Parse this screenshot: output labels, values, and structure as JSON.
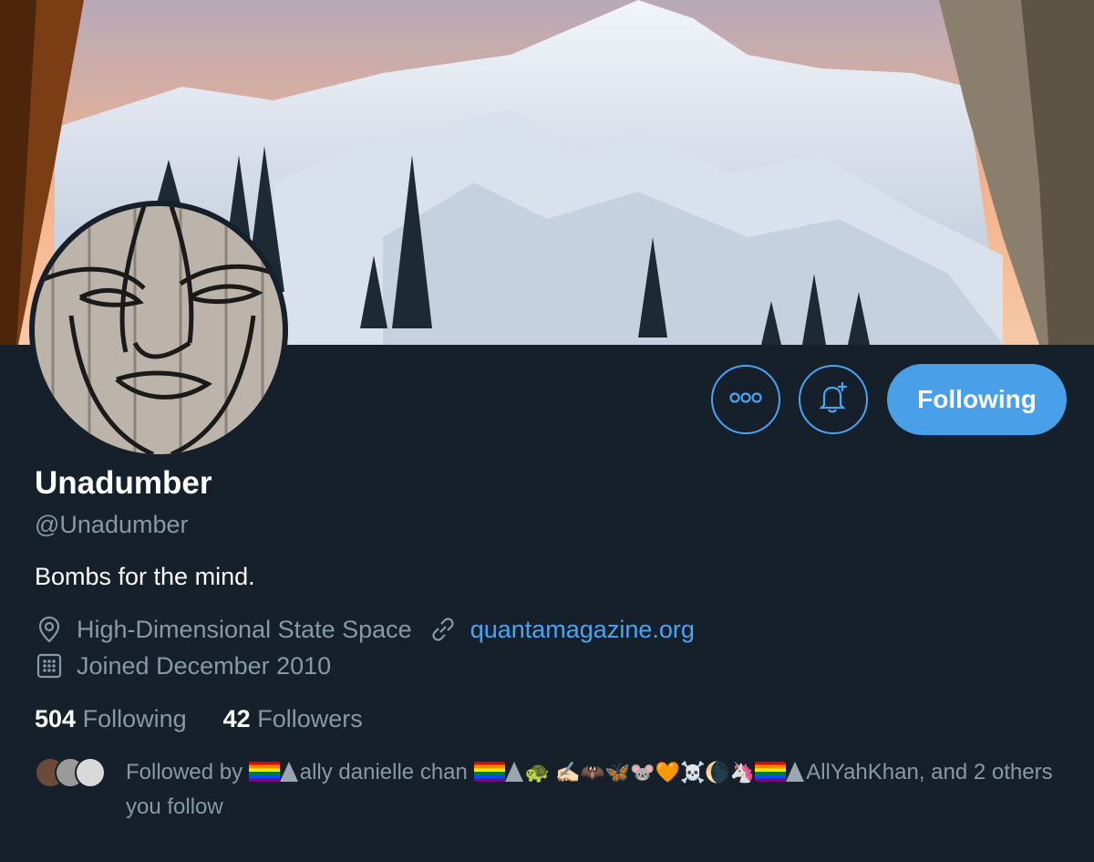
{
  "profile": {
    "display_name": "Unadumber",
    "handle": "@Unadumber",
    "bio": "Bombs for the mind.",
    "location": "High-Dimensional State Space",
    "website": "quantamagazine.org",
    "joined": "Joined December 2010"
  },
  "stats": {
    "following_count": "504",
    "following_label": "Following",
    "followers_count": "42",
    "followers_label": "Followers"
  },
  "actions": {
    "following_button": "Following"
  },
  "followed_by": {
    "prefix": "Followed by",
    "name_1": "ally danielle chan",
    "emoji_run": "🐢 ✍🏻🦇🦋🐭🧡☠️🌘🦄",
    "name_2": "AllYahKhan, and 2 others you follow"
  },
  "icons": {
    "more": "more-horizontal-icon",
    "notify": "bell-plus-icon",
    "location": "location-pin-icon",
    "link": "link-icon",
    "calendar": "calendar-icon"
  },
  "colors": {
    "background": "#15202b",
    "accent": "#4aa4f4",
    "secondary_text": "#8899a6"
  }
}
